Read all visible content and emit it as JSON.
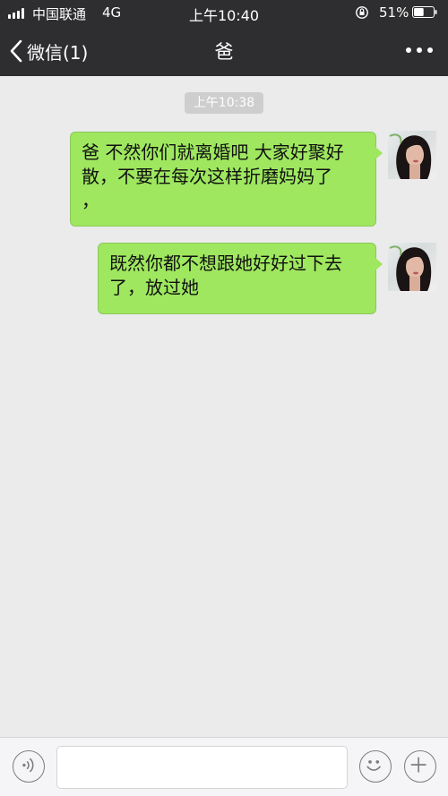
{
  "status_bar": {
    "carrier": "中国联通",
    "network": "4G",
    "time": "上午10:40",
    "battery_percent": "51%",
    "battery_level": 0.51,
    "icons": [
      "signal-icon",
      "rotation-lock-icon",
      "battery-icon"
    ]
  },
  "nav": {
    "back_label": "微信(1)",
    "title": "爸",
    "icons": [
      "chevron-left-icon",
      "more-icon"
    ]
  },
  "chat": {
    "timestamp": "上午10:38",
    "messages": [
      {
        "sender": "me",
        "text": "爸 不然你们就离婚吧 大家好聚好散，不要在每次这样折磨妈妈了\n，"
      },
      {
        "sender": "me",
        "text": "既然你都不想跟她好好过下去了，放过她"
      }
    ]
  },
  "input_bar": {
    "value": "",
    "icons": [
      "voice-icon",
      "emoji-icon",
      "plus-icon"
    ]
  },
  "colors": {
    "bar_background": "#2e2e30",
    "chat_background": "#ebebeb",
    "bubble_green": "#9ee75f"
  }
}
